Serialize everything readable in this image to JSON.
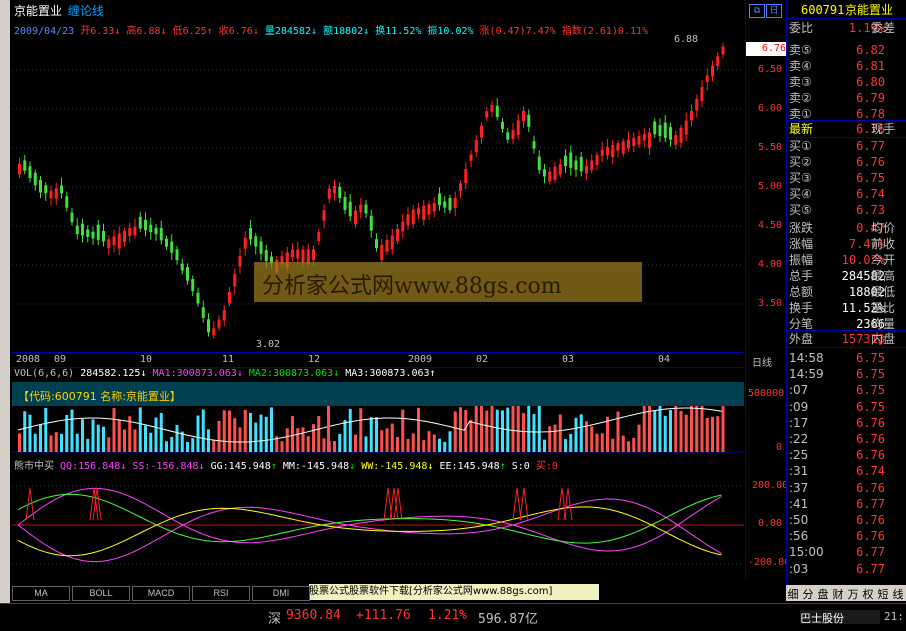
{
  "stock": {
    "name": "京能置业",
    "code": "600791",
    "chart_type": "缠论线"
  },
  "info_bar": {
    "date": "2009/04/23",
    "open_label": "开",
    "open": "6.33",
    "high_label": "高",
    "high": "6.88",
    "low_label": "低",
    "low": "6.25",
    "close_label": "收",
    "close": "6.76",
    "vol_label": "量",
    "vol": "284582",
    "amt_label": "额",
    "amt": "18802",
    "turn_label": "换",
    "turn": "11.52%",
    "amp_label": "振",
    "amp": "10.02%",
    "rise_label": "涨",
    "rise": "(0.47)7.47%",
    "idx_label": "指数",
    "idx": "(2.61)0.11%"
  },
  "price_axis": [
    "6.50",
    "6.00",
    "5.50",
    "5.00",
    "4.50",
    "4.00",
    "3.50"
  ],
  "price_marks": {
    "high": "6.88",
    "low": "3.02",
    "current": "6.76"
  },
  "time_axis": [
    "2008",
    "09",
    "10",
    "11",
    "12",
    "2009",
    "02",
    "03",
    "04"
  ],
  "period_label": "日线",
  "volume": {
    "label": "VOL(6,6,6)",
    "value": "284582.125",
    "ma1": "MA1:300873.063",
    "ma2": "MA2:300873.063",
    "ma3": "MA3:300873.063",
    "axis": [
      "500000",
      "0"
    ],
    "banner": "【代码:600791 名称:京能置业】"
  },
  "indicator": {
    "name": "熊市中买",
    "qq": "QQ:156.848",
    "ss": "SS:-156.848",
    "gg": "GG:145.948",
    "mm": "MM:-145.948",
    "ww": "WW:-145.948",
    "ee": "EE:145.948",
    "s": "S:0",
    "buy": "买:0",
    "axis": [
      "200.00",
      "0.00",
      "-200.00"
    ]
  },
  "watermark": "分析家公式网www.88gs.com",
  "footer_banner": "股票公式股票软件下载[分析家公式网www.88gs.com]",
  "tabs": [
    "MA",
    "BOLL",
    "MACD",
    "RSI",
    "DMI"
  ],
  "status": {
    "market": "深",
    "index": "9360.84",
    "change": "+111.76",
    "pct": "1.21%",
    "amount": "596.87亿"
  },
  "panel": {
    "code": "600791",
    "name": "京能置业",
    "weibi_label": "委比",
    "weibi": "1.19%",
    "weicha_label": "委差",
    "sells": [
      {
        "label": "卖⑤",
        "price": "6.82"
      },
      {
        "label": "卖④",
        "price": "6.81"
      },
      {
        "label": "卖③",
        "price": "6.80"
      },
      {
        "label": "卖②",
        "price": "6.79"
      },
      {
        "label": "卖①",
        "price": "6.78"
      }
    ],
    "last_label": "最新",
    "last": "6.76",
    "last_right": "现手",
    "buys": [
      {
        "label": "买①",
        "price": "6.77"
      },
      {
        "label": "买②",
        "price": "6.76"
      },
      {
        "label": "买③",
        "price": "6.75"
      },
      {
        "label": "买④",
        "price": "6.74"
      },
      {
        "label": "买⑤",
        "price": "6.73"
      }
    ],
    "stats": [
      {
        "label": "涨跌",
        "value": "0.47",
        "right": "均价"
      },
      {
        "label": "涨幅",
        "value": "7.47%",
        "right": "前收"
      },
      {
        "label": "振幅",
        "value": "10.02%",
        "right": "今开"
      },
      {
        "label": "总手",
        "value": "284582",
        "right": "最高"
      },
      {
        "label": "总额",
        "value": "18802",
        "right": "最低"
      },
      {
        "label": "换手",
        "value": "11.52%",
        "right": "量比"
      },
      {
        "label": "分笔",
        "value": "2366",
        "right": "均量"
      }
    ],
    "outer_label": "外盘",
    "outer": "157313",
    "inner_label": "内盘",
    "ticks": [
      {
        "time": "14:58",
        "price": "6.75"
      },
      {
        "time": "14:59",
        "price": "6.75"
      },
      {
        "time": ":07",
        "price": "6.75"
      },
      {
        "time": ":09",
        "price": "6.75"
      },
      {
        "time": ":17",
        "price": "6.76"
      },
      {
        "time": ":22",
        "price": "6.76"
      },
      {
        "time": ":25",
        "price": "6.76"
      },
      {
        "time": ":31",
        "price": "6.74"
      },
      {
        "time": ":37",
        "price": "6.76"
      },
      {
        "time": ":41",
        "price": "6.77"
      },
      {
        "time": ":50",
        "price": "6.76"
      },
      {
        "time": ":56",
        "price": "6.76"
      },
      {
        "time": "15:00",
        "price": "6.77"
      },
      {
        "time": ":03",
        "price": "6.77"
      }
    ],
    "bottom_tabs": [
      "细",
      "分",
      "盘",
      "财",
      "万",
      "权",
      "短",
      "线"
    ],
    "bottom_name": "巴士股份",
    "bottom_time": "21:"
  },
  "colors": {
    "up": "#ff3232",
    "down": "#00e600",
    "bg": "#000000",
    "axis": "#0000aa"
  },
  "icons": [
    "window-restore-icon",
    "date-box-icon"
  ]
}
